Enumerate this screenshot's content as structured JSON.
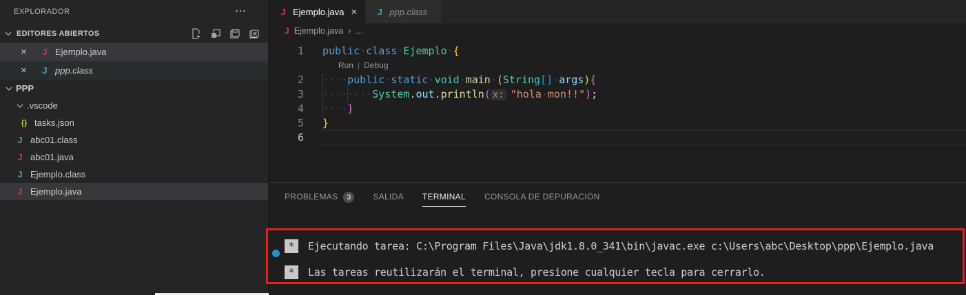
{
  "sidebar": {
    "title": "EXPLORADOR",
    "more_icon": "⋯",
    "open_editors_section": {
      "label": "EDITORES ABIERTOS"
    },
    "open_editors": [
      {
        "close": "×",
        "icon": "java-red",
        "label": "Ejemplo.java",
        "selected": true
      },
      {
        "close": "×",
        "icon": "java-blue",
        "label": "ppp.class",
        "italic": true,
        "hover": true
      }
    ],
    "tree": [
      {
        "label": "PPP",
        "chevron": true,
        "bold": true,
        "indent": 0
      },
      {
        "label": ".vscode",
        "chevron": true,
        "indent": 1
      },
      {
        "label": "tasks.json",
        "icon": "json",
        "indent": 2
      },
      {
        "label": "abc01.class",
        "icon": "java-blue",
        "indent": 1
      },
      {
        "label": "abc01.java",
        "icon": "java-red",
        "indent": 1
      },
      {
        "label": "Ejemplo.class",
        "icon": "java-blue",
        "indent": 1
      },
      {
        "label": "Ejemplo.java",
        "icon": "java-red",
        "indent": 1,
        "selected": true
      }
    ]
  },
  "tabbar": {
    "tabs": [
      {
        "icon": "java-red",
        "label": "Ejemplo.java",
        "close": "×",
        "active": true
      },
      {
        "icon": "java-blue",
        "label": "ppp.class",
        "italic": true
      }
    ]
  },
  "breadcrumb": {
    "file": "Ejemplo.java",
    "separator": "›",
    "more": "..."
  },
  "editor": {
    "codelens": {
      "run": "Run",
      "separator": "|",
      "debug": "Debug"
    },
    "lines": [
      {
        "num": "1",
        "tokens": [
          [
            "public",
            "kw"
          ],
          [
            "·",
            "ws"
          ],
          [
            "class",
            "kw"
          ],
          [
            "·",
            "ws"
          ],
          [
            "Ejemplo",
            "type"
          ],
          [
            "·",
            "ws"
          ],
          [
            "{",
            "b1"
          ]
        ]
      },
      {
        "num": "2",
        "tokens": [
          [
            "····",
            "ws"
          ],
          [
            "public",
            "kw"
          ],
          [
            "·",
            "ws"
          ],
          [
            "static",
            "kw"
          ],
          [
            "·",
            "ws"
          ],
          [
            "void",
            "type"
          ],
          [
            "·",
            "ws"
          ],
          [
            "main",
            "fn"
          ],
          [
            "·",
            "ws"
          ],
          [
            "(",
            "b1"
          ],
          [
            "String",
            "type"
          ],
          [
            "[]",
            "b3"
          ],
          [
            "·",
            "ws"
          ],
          [
            "args",
            "var"
          ],
          [
            ")",
            "b1"
          ],
          [
            "{",
            "b2"
          ]
        ]
      },
      {
        "num": "3",
        "tokens": [
          [
            "····",
            "ws"
          ],
          [
            "····",
            "ws"
          ],
          [
            "System",
            "type"
          ],
          [
            ".",
            "pl"
          ],
          [
            "out",
            "var"
          ],
          [
            ".",
            "pl"
          ],
          [
            "println",
            "fn"
          ],
          [
            "(",
            "b2"
          ],
          [
            "x:",
            "hint"
          ],
          [
            "\"hola",
            "str"
          ],
          [
            "·",
            "ws"
          ],
          [
            "mon!!\"",
            "str"
          ],
          [
            ")",
            "b2"
          ],
          [
            ";",
            "pl"
          ]
        ]
      },
      {
        "num": "4",
        "tokens": [
          [
            "····",
            "ws"
          ],
          [
            "}",
            "b2"
          ]
        ]
      },
      {
        "num": "5",
        "tokens": [
          [
            "}",
            "b1"
          ]
        ]
      },
      {
        "num": "6",
        "tokens": [],
        "current": true
      }
    ]
  },
  "panel": {
    "tabs": [
      {
        "label": "PROBLEMAS",
        "badge": "3"
      },
      {
        "label": "SALIDA"
      },
      {
        "label": "TERMINAL",
        "active": true
      },
      {
        "label": "CONSOLA DE DEPURACIÓN"
      }
    ],
    "terminal": {
      "lines": [
        {
          "bullet": true,
          "marker": "*",
          "text": "Ejecutando tarea: C:\\Program Files\\Java\\jdk1.8.0_341\\bin\\javac.exe c:\\Users\\abc\\Desktop\\ppp\\Ejemplo.java"
        },
        {
          "marker": "*",
          "text": "Las tareas reutilizarán el terminal, presione cualquier tecla para cerrarlo."
        }
      ]
    }
  }
}
